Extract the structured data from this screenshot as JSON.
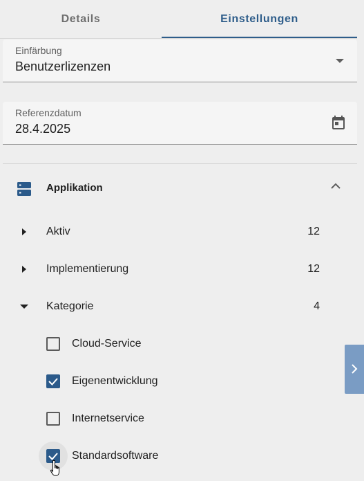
{
  "tabs": [
    {
      "label": "Details",
      "active": false
    },
    {
      "label": "Einstellungen",
      "active": true
    }
  ],
  "coloring": {
    "label": "Einfärbung",
    "value": "Benutzerlizenzen"
  },
  "reference_date": {
    "label": "Referenzdatum",
    "value": "28.4.2025"
  },
  "application": {
    "title": "Applikation",
    "expanded": true,
    "attributes": [
      {
        "label": "Aktiv",
        "count": "12",
        "expanded": false
      },
      {
        "label": "Implementierung",
        "count": "12",
        "expanded": false
      },
      {
        "label": "Kategorie",
        "count": "4",
        "expanded": true
      }
    ],
    "category_options": [
      {
        "label": "Cloud-Service",
        "checked": false
      },
      {
        "label": "Eigenentwicklung",
        "checked": true
      },
      {
        "label": "Internetservice",
        "checked": false
      },
      {
        "label": "Standardsoftware",
        "checked": true
      }
    ]
  },
  "colors": {
    "accent": "#2e5d8a",
    "checkbox": "#2b5a8a",
    "side_toggle": "#7a9cc4",
    "background": "#eeeeee"
  },
  "icons": {
    "date_picker": "calendar-icon",
    "section": "server-icon",
    "collapse": "chevron-up-icon",
    "side_toggle": "chevron-right-icon"
  }
}
